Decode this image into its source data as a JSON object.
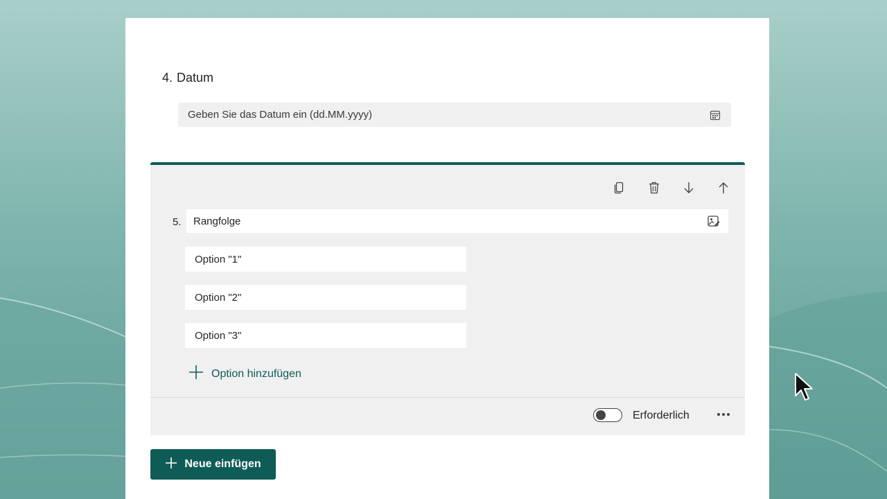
{
  "question4": {
    "number": "4.",
    "title": "Datum",
    "date_placeholder": "Geben Sie das Datum ein (dd.MM.yyyy)",
    "date_icon": "calendar-icon"
  },
  "question5": {
    "number": "5.",
    "title": "Rangfolge",
    "toolbar": {
      "copy_icon": "copy-icon",
      "delete_icon": "trash-icon",
      "move_down_icon": "arrow-down-icon",
      "move_up_icon": "arrow-up-icon"
    },
    "image_icon": "insert-media-icon",
    "options": [
      "Option \"1\"",
      "Option \"2\"",
      "Option \"3\""
    ],
    "add_option_label": "Option hinzufügen",
    "required_label": "Erforderlich",
    "required_on": false,
    "more_icon": "ellipsis-icon"
  },
  "insert_button_label": "Neue einfügen",
  "colors": {
    "accent": "#0f5c56",
    "panel": "#f0f0f0",
    "background": "#7fb5ae"
  }
}
